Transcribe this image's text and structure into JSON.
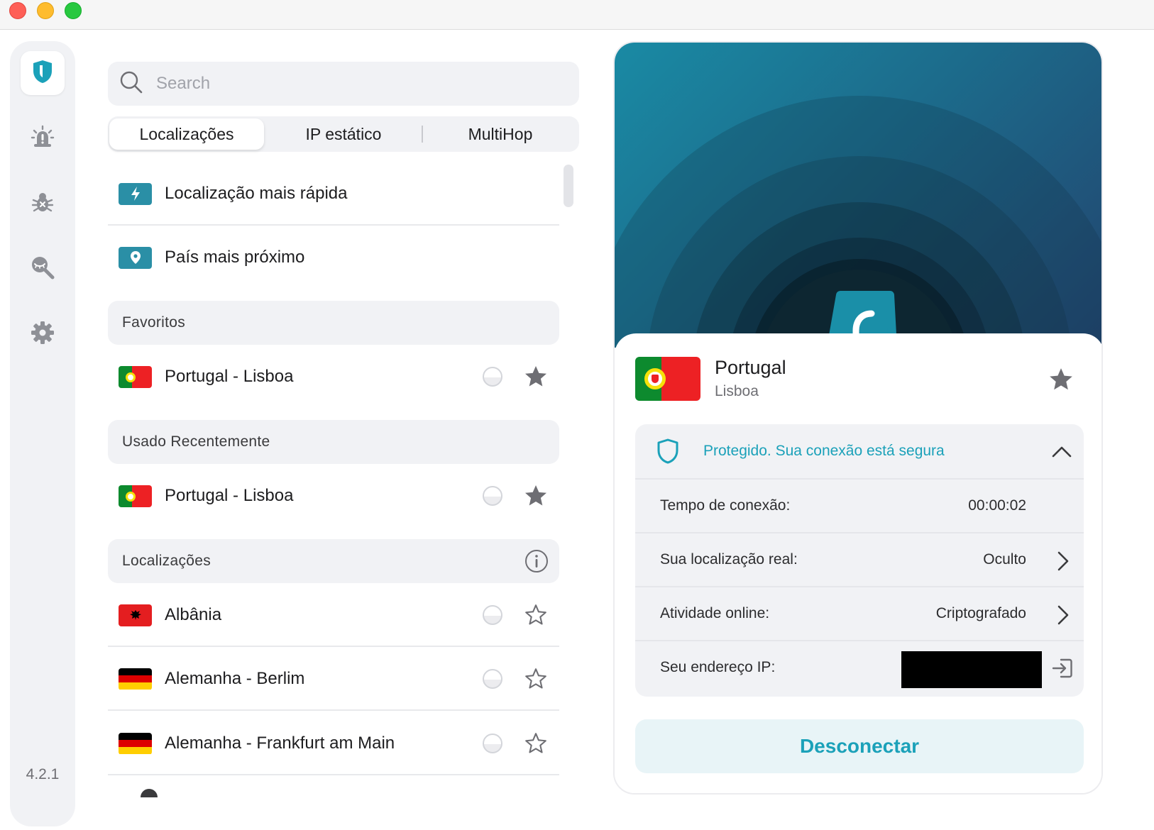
{
  "window": {
    "title": ""
  },
  "sidebar": {
    "version": "4.2.1",
    "items": [
      {
        "icon": "shield-icon",
        "active": true
      },
      {
        "icon": "alert-icon",
        "active": false
      },
      {
        "icon": "bug-icon",
        "active": false
      },
      {
        "icon": "search-eye-icon",
        "active": false
      },
      {
        "icon": "gear-icon",
        "active": false
      }
    ]
  },
  "search": {
    "placeholder": "Search",
    "value": ""
  },
  "tabs": [
    {
      "label": "Localizações",
      "selected": true
    },
    {
      "label": "IP estático",
      "selected": false
    },
    {
      "label": "MultiHop",
      "selected": false
    }
  ],
  "quick": {
    "fastest": "Localização mais rápida",
    "nearest": "País mais próximo"
  },
  "favorites": {
    "title": "Favoritos",
    "items": [
      {
        "label": "Portugal - Lisboa",
        "flag": "pt",
        "favorite": true
      }
    ]
  },
  "recent": {
    "title": "Usado Recentemente",
    "items": [
      {
        "label": "Portugal - Lisboa",
        "flag": "pt",
        "favorite": true
      }
    ]
  },
  "locations": {
    "title": "Localizações",
    "items": [
      {
        "label": "Albânia",
        "flag": "al",
        "favorite": false
      },
      {
        "label": "Alemanha - Berlim",
        "flag": "de",
        "favorite": false
      },
      {
        "label": "Alemanha - Frankfurt am Main",
        "flag": "de",
        "favorite": false
      }
    ]
  },
  "connection": {
    "country": "Portugal",
    "city": "Lisboa",
    "status": "Protegido. Sua conexão está segura",
    "rows": [
      {
        "label": "Tempo de conexão:",
        "value": "00:00:02"
      },
      {
        "label": "Sua localização real:",
        "value": "Oculto"
      },
      {
        "label": "Atividade online:",
        "value": "Criptografado"
      },
      {
        "label": "Seu endereço IP:",
        "value": ""
      }
    ],
    "disconnect_label": "Desconectar"
  },
  "colors": {
    "accent": "#1ba1b9",
    "hero_start": "#1a8aa4",
    "hero_end": "#22446e",
    "pt_green": "#0d8a2e",
    "pt_red": "#ed2124"
  }
}
